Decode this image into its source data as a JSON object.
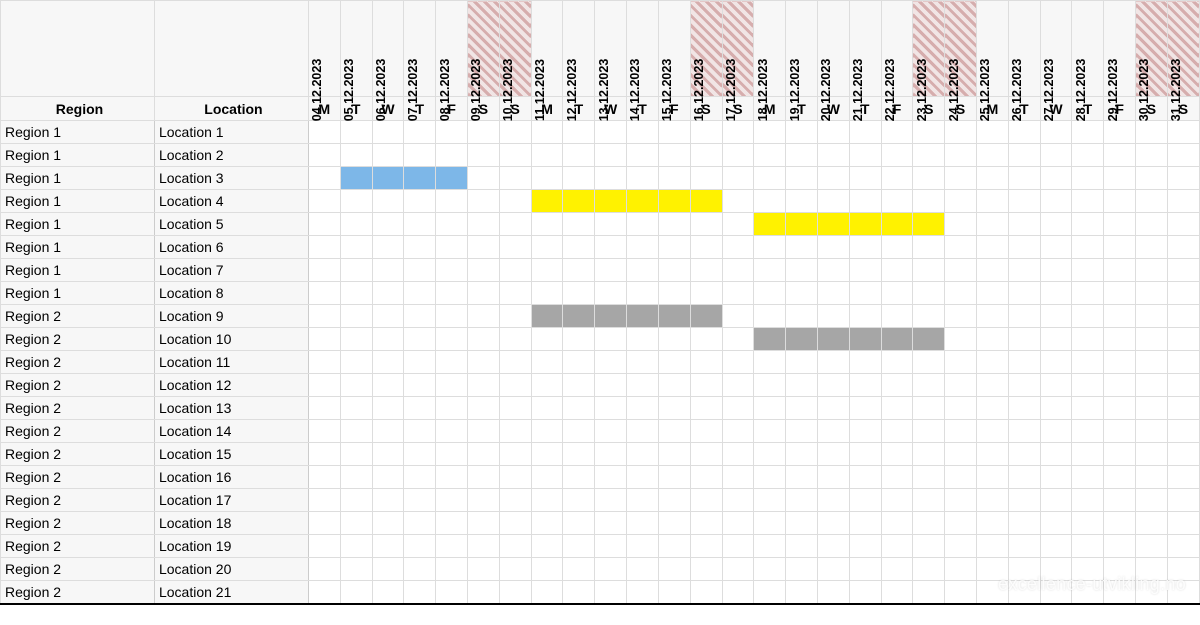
{
  "headers": {
    "region": "Region",
    "location": "Location"
  },
  "dates": [
    {
      "date": "04.12.2023",
      "dow": "M",
      "weekend": false
    },
    {
      "date": "05.12.2023",
      "dow": "T",
      "weekend": false
    },
    {
      "date": "06.12.2023",
      "dow": "W",
      "weekend": false
    },
    {
      "date": "07.12.2023",
      "dow": "T",
      "weekend": false
    },
    {
      "date": "08.12.2023",
      "dow": "F",
      "weekend": false
    },
    {
      "date": "09.12.2023",
      "dow": "S",
      "weekend": true
    },
    {
      "date": "10.12.2023",
      "dow": "S",
      "weekend": true
    },
    {
      "date": "11.12.2023",
      "dow": "M",
      "weekend": false
    },
    {
      "date": "12.12.2023",
      "dow": "T",
      "weekend": false
    },
    {
      "date": "13.12.2023",
      "dow": "W",
      "weekend": false
    },
    {
      "date": "14.12.2023",
      "dow": "T",
      "weekend": false
    },
    {
      "date": "15.12.2023",
      "dow": "F",
      "weekend": false
    },
    {
      "date": "16.12.2023",
      "dow": "S",
      "weekend": true
    },
    {
      "date": "17.12.2023",
      "dow": "S",
      "weekend": true
    },
    {
      "date": "18.12.2023",
      "dow": "M",
      "weekend": false
    },
    {
      "date": "19.12.2023",
      "dow": "T",
      "weekend": false
    },
    {
      "date": "20.12.2023",
      "dow": "W",
      "weekend": false
    },
    {
      "date": "21.12.2023",
      "dow": "T",
      "weekend": false
    },
    {
      "date": "22.12.2023",
      "dow": "F",
      "weekend": false
    },
    {
      "date": "23.12.2023",
      "dow": "S",
      "weekend": true
    },
    {
      "date": "24.12.2023",
      "dow": "S",
      "weekend": true
    },
    {
      "date": "25.12.2023",
      "dow": "M",
      "weekend": false
    },
    {
      "date": "26.12.2023",
      "dow": "T",
      "weekend": false
    },
    {
      "date": "27.12.2023",
      "dow": "W",
      "weekend": false
    },
    {
      "date": "28.12.2023",
      "dow": "T",
      "weekend": false
    },
    {
      "date": "29.12.2023",
      "dow": "F",
      "weekend": false
    },
    {
      "date": "30.12.2023",
      "dow": "S",
      "weekend": true
    },
    {
      "date": "31.12.2023",
      "dow": "S",
      "weekend": true
    }
  ],
  "rows": [
    {
      "region": "Region 1",
      "location": "Location 1",
      "bars": []
    },
    {
      "region": "Region 1",
      "location": "Location 2",
      "bars": []
    },
    {
      "region": "Region 1",
      "location": "Location 3",
      "bars": [
        {
          "start": 1,
          "end": 4,
          "color": "blue"
        }
      ]
    },
    {
      "region": "Region 1",
      "location": "Location 4",
      "bars": [
        {
          "start": 7,
          "end": 12,
          "color": "yellow"
        }
      ]
    },
    {
      "region": "Region 1",
      "location": "Location 5",
      "bars": [
        {
          "start": 14,
          "end": 19,
          "color": "yellow"
        }
      ]
    },
    {
      "region": "Region 1",
      "location": "Location 6",
      "bars": []
    },
    {
      "region": "Region 1",
      "location": "Location 7",
      "bars": []
    },
    {
      "region": "Region 1",
      "location": "Location 8",
      "bars": []
    },
    {
      "region": "Region 2",
      "location": "Location 9",
      "bars": [
        {
          "start": 7,
          "end": 12,
          "color": "gray"
        }
      ]
    },
    {
      "region": "Region 2",
      "location": "Location 10",
      "bars": [
        {
          "start": 14,
          "end": 19,
          "color": "gray"
        }
      ]
    },
    {
      "region": "Region 2",
      "location": "Location 11",
      "bars": []
    },
    {
      "region": "Region 2",
      "location": "Location 12",
      "bars": []
    },
    {
      "region": "Region 2",
      "location": "Location 13",
      "bars": []
    },
    {
      "region": "Region 2",
      "location": "Location 14",
      "bars": []
    },
    {
      "region": "Region 2",
      "location": "Location 15",
      "bars": []
    },
    {
      "region": "Region 2",
      "location": "Location 16",
      "bars": []
    },
    {
      "region": "Region 2",
      "location": "Location 17",
      "bars": []
    },
    {
      "region": "Region 2",
      "location": "Location 18",
      "bars": []
    },
    {
      "region": "Region 2",
      "location": "Location 19",
      "bars": []
    },
    {
      "region": "Region 2",
      "location": "Location 20",
      "bars": []
    },
    {
      "region": "Region 2",
      "location": "Location 21",
      "bars": []
    }
  ],
  "watermark": "excellence-utvikling.no"
}
